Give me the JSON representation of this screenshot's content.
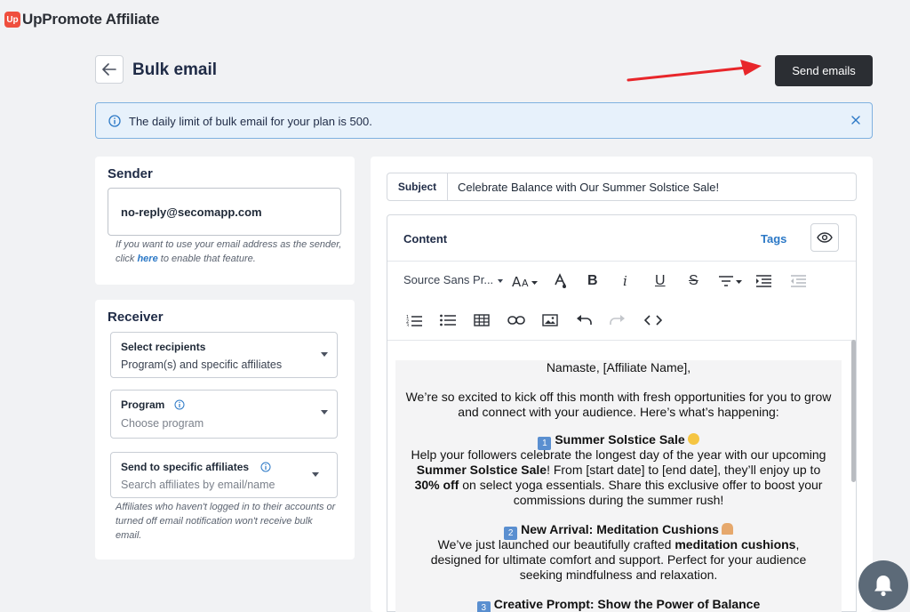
{
  "app": {
    "logo_text": "Up",
    "title": "UpPromote Affiliate"
  },
  "header": {
    "title": "Bulk email",
    "send_label": "Send emails"
  },
  "banner": {
    "text": "The daily limit of bulk email for your plan is 500."
  },
  "sender": {
    "title": "Sender",
    "value": "no-reply@secomapp.com",
    "hint_before": "If you want to use your email address as the sender, click ",
    "hint_link": "here",
    "hint_after": " to enable that feature."
  },
  "receiver": {
    "title": "Receiver",
    "recipients_label": "Select recipients",
    "recipients_value": "Program(s) and specific affiliates",
    "program_label": "Program",
    "program_placeholder": "Choose program",
    "affiliates_label": "Send to specific affiliates",
    "affiliates_placeholder": "Search affiliates by email/name",
    "note": "Affiliates who haven't logged in to their accounts or turned off email notification won't receive bulk email."
  },
  "editor": {
    "subject_label": "Subject",
    "subject_value": "Celebrate Balance with Our Summer Solstice Sale!",
    "content_label": "Content",
    "tags_label": "Tags",
    "font_name": "Source Sans Pr...",
    "doc": {
      "greeting": "Namaste, [Affiliate Name],",
      "intro": "We’re so excited to kick off this month with fresh opportunities for you to grow and connect with your audience. Here’s what’s happening:",
      "s1_num": "1",
      "s1_title": "Summer Solstice Sale",
      "s1_a": "Help your followers celebrate the longest day of the year with our upcoming ",
      "s1_b": "Summer Solstice Sale",
      "s1_c": "! From [start date] to [end date], they’ll enjoy up to ",
      "s1_d": "30% off",
      "s1_e": " on select yoga essentials. Share this exclusive offer to boost your commissions during the summer rush!",
      "s2_num": "2",
      "s2_title": "New Arrival: Meditation Cushions",
      "s2_a": "We’ve just launched our beautifully crafted ",
      "s2_b": "meditation cushions",
      "s2_c": ", designed for ultimate comfort and support. Perfect for your audience seeking mindfulness and relaxation.",
      "s3_num": "3",
      "s3_title": "Creative Prompt: Show the Power of Balance"
    }
  },
  "colors": {
    "accent": "#2b78c6",
    "dark_button": "#2b2e33",
    "banner_bg": "#e7f1fb",
    "arrow": "#e8262a"
  }
}
